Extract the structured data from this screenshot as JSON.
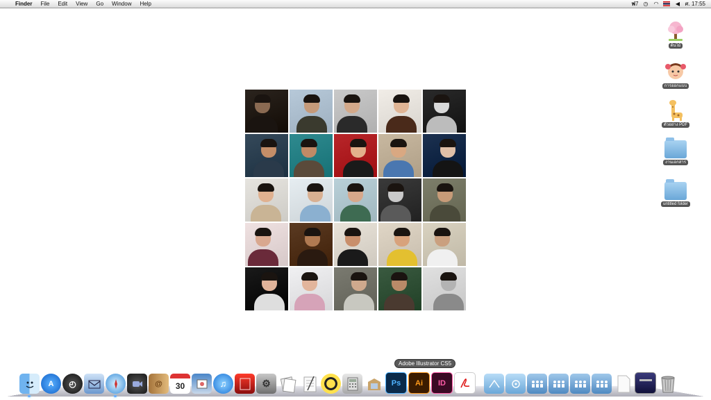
{
  "menubar": {
    "app": "Finder",
    "items": [
      "File",
      "Edit",
      "View",
      "Go",
      "Window",
      "Help"
    ],
    "status_text_1": "7",
    "clock": "ศ. 17:55"
  },
  "desktop_icons": [
    {
      "label": "ต้นไม้",
      "kind": "tree"
    },
    {
      "label": "การออกแบบ",
      "kind": "girl"
    },
    {
      "label": "ตัวอย่าง PDF",
      "kind": "giraffe"
    },
    {
      "label": "งานเอกสาร",
      "kind": "folder"
    },
    {
      "label": "untitled folder",
      "kind": "folder"
    }
  ],
  "dock": {
    "tooltip": "Adobe Illustrator CS5",
    "calendar_day": "30",
    "ps_label": "Ps",
    "ai_label": "Ai",
    "id_label": "ID"
  },
  "colors": {
    "ps": "#1a76c8",
    "ai": "#f08c12",
    "id": "#c8287a",
    "folder": "#7ab4e0"
  }
}
